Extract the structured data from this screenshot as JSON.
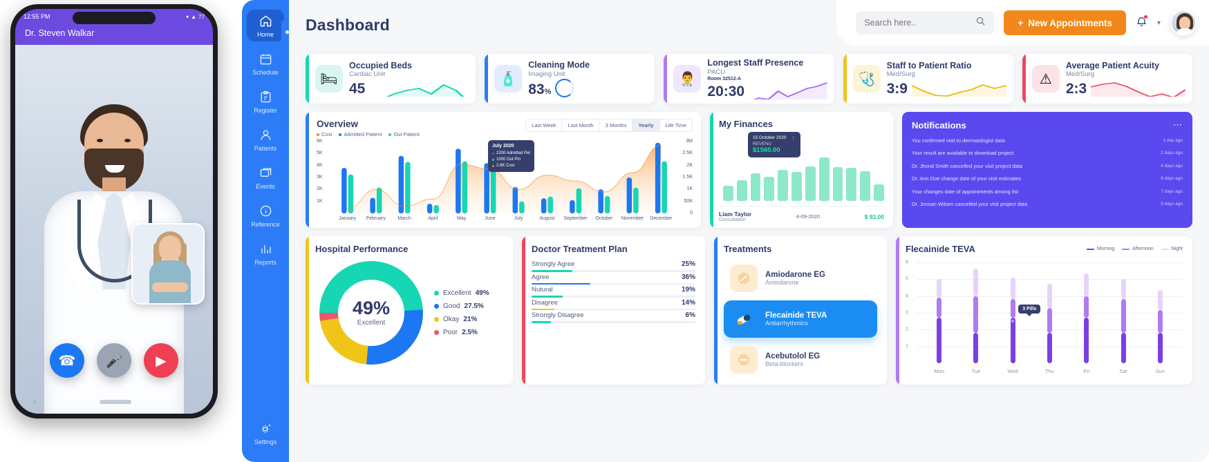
{
  "phone": {
    "status_time": "12:55 PM",
    "status_icons": "signal-wifi-battery",
    "battery": "77",
    "doctor_name": "Dr. Steven Walkar",
    "call_buttons": [
      {
        "name": "call-button",
        "glyph": "✆"
      },
      {
        "name": "mute-button",
        "glyph": "🎤"
      },
      {
        "name": "end-video-button",
        "glyph": "▶"
      }
    ],
    "back_glyph": "‹"
  },
  "sidebar": {
    "items": [
      {
        "label": "Home",
        "icon": "home-icon",
        "active": true
      },
      {
        "label": "Schedule",
        "icon": "calendar-icon",
        "active": false
      },
      {
        "label": "Register",
        "icon": "clipboard-edit-icon",
        "active": false
      },
      {
        "label": "Patients",
        "icon": "user-icon",
        "active": false
      },
      {
        "label": "Events",
        "icon": "layers-icon",
        "active": false
      },
      {
        "label": "Reference",
        "icon": "info-icon",
        "active": false
      },
      {
        "label": "Reports",
        "icon": "bar-chart-icon",
        "active": false
      }
    ],
    "bottom": {
      "label": "Settings",
      "icon": "gear-icon"
    }
  },
  "header": {
    "title": "Dashboard",
    "search_placeholder": "Search here..",
    "search_value": "",
    "search_icon": "search-icon",
    "new_appointments": "New Appointments",
    "plus": "+",
    "bell_icon": "bell-icon",
    "chevron": "▾",
    "accent_orange": "#f2881b"
  },
  "stats": [
    {
      "title": "Occupied Beds",
      "subtitle": "Cardiac Unit",
      "value": "45",
      "unit": "",
      "room": "",
      "bar_color": "#15d8b0",
      "icon_bg": "#d9f7f0",
      "icon": "patient-bed-icon",
      "glyph": "🛏",
      "spark_color": "#15d8b0",
      "spark_fill": "#d9f7f0",
      "spark": [
        46,
        30,
        22,
        17,
        14,
        22,
        9,
        17,
        34
      ],
      "mode": "spark"
    },
    {
      "title": "Cleaning Mode",
      "subtitle": "Imaging Unit",
      "value": "83",
      "unit": "%",
      "room": "",
      "bar_color": "#2b7cf6",
      "icon_bg": "#e3ecfd",
      "icon": "cleaning-supplies-icon",
      "glyph": "🧴",
      "spark_color": "#1b78f2",
      "spark_fill": "#e3ecfd",
      "spark": [],
      "mode": "ring",
      "ring_pct": "83"
    },
    {
      "title": "Longest Staff Presence",
      "subtitle": "PACU",
      "value": "20:30",
      "unit": "",
      "room": "Room 32512-A",
      "bar_color": "#b07bf0",
      "icon_bg": "#f0e6fd",
      "icon": "doctor-clock-icon",
      "glyph": "👨‍⚕",
      "spark_color": "#a765ef",
      "spark_fill": "#f0e6fd",
      "spark": [
        30,
        24,
        26,
        14,
        22,
        16,
        10,
        7,
        2
      ],
      "mode": "spark"
    },
    {
      "title": "Staff to Patient Ratio",
      "subtitle": "Med/Surg",
      "value": "3:9",
      "unit": "",
      "room": "",
      "bar_color": "#f0c419",
      "icon_bg": "#fdf4d6",
      "icon": "nurse-patient-icon",
      "glyph": "🩺",
      "spark_color": "#eab90f",
      "spark_fill": "#fdf4d6",
      "spark": [
        10,
        18,
        24,
        25,
        20,
        16,
        9,
        14,
        10
      ],
      "mode": "spark"
    },
    {
      "title": "Average Patient Acuity",
      "subtitle": "Med/Surg",
      "value": "2:3",
      "unit": "",
      "room": "",
      "bar_color": "#f0465e",
      "icon_bg": "#fde3e7",
      "icon": "warning-triangle-icon",
      "glyph": "⚠",
      "spark_color": "#f0556b",
      "spark_fill": "#fde3e7",
      "spark": [
        12,
        8,
        6,
        11,
        19,
        26,
        22,
        27,
        16
      ],
      "mode": "spark"
    }
  ],
  "overview": {
    "title": "Overview",
    "accent": "#2b7cf6",
    "legend": [
      {
        "label": "Cost",
        "color": "#f2881b"
      },
      {
        "label": "Admitted Patient",
        "color": "#1b78f2"
      },
      {
        "label": "Out Patient",
        "color": "#17d6b4"
      }
    ],
    "tabs": [
      {
        "label": "Last Week",
        "active": false
      },
      {
        "label": "Last Month",
        "active": false
      },
      {
        "label": "3 Months",
        "active": false
      },
      {
        "label": "Yearly",
        "active": true
      },
      {
        "label": "Life Time",
        "active": false
      }
    ],
    "tooltip": {
      "title": "July 2020",
      "rows": [
        {
          "label": "2200 Admitted Per",
          "color": "#1b78f2"
        },
        {
          "label": "1000 Out Pin",
          "color": "#17d6b4"
        },
        {
          "label": "2.8K Cost",
          "color": "#f2881b"
        }
      ]
    },
    "chart_data": {
      "type": "bar",
      "title": "Overview",
      "xlabel": "",
      "ylabel": "",
      "grid": false,
      "legend_position": "top-left",
      "categories": [
        "January",
        "February",
        "March",
        "April",
        "May",
        "June",
        "July",
        "August",
        "September",
        "October",
        "November",
        "December"
      ],
      "y_left_ticks": [
        "6K",
        "5K",
        "4K",
        "3K",
        "2K",
        "1K"
      ],
      "y_right_ticks": [
        "3M",
        "2.5K",
        "2K",
        "1.5K",
        "1K",
        "50K",
        "0"
      ],
      "ylim": [
        0,
        6000
      ],
      "series": [
        {
          "name": "Admitted Patient",
          "type": "bar",
          "color": "#1b78f2",
          "values": [
            3800,
            1300,
            4800,
            800,
            5400,
            4200,
            2200,
            1250,
            1100,
            2000,
            3000,
            5900
          ]
        },
        {
          "name": "Out Patient",
          "type": "bar",
          "color": "#17d6b4",
          "values": [
            3250,
            2150,
            4300,
            700,
            4350,
            3650,
            1000,
            1400,
            2100,
            1450,
            2150,
            4350
          ]
        },
        {
          "name": "Cost",
          "type": "area",
          "color": "#f2881b",
          "values": [
            400,
            2000,
            600,
            1200,
            4100,
            3700,
            2000,
            3200,
            2700,
            1800,
            3400,
            5700
          ]
        }
      ]
    }
  },
  "finances": {
    "title": "My Finances",
    "accent": "#15d8b0",
    "tooltip": {
      "date": "15 October 2020",
      "menu": "⋮",
      "label": "REVENU",
      "amount": "$1560.00"
    },
    "footer": {
      "name": "Liam Taylor",
      "sub": "Consultation",
      "date": "4-09-2020",
      "amount": "$ 92.00"
    },
    "chart_data": {
      "type": "bar",
      "title": "My Finances",
      "categories": [
        "1",
        "2",
        "3",
        "4",
        "5",
        "6",
        "7",
        "8",
        "9",
        "10",
        "11",
        "12"
      ],
      "values": [
        30,
        42,
        55,
        48,
        62,
        58,
        70,
        88,
        68,
        66,
        60,
        34
      ],
      "ylim": [
        0,
        100
      ],
      "color": "#8ee8cb"
    }
  },
  "notifications": {
    "title": "Notifications",
    "menu_icon": "more-horizontal-icon",
    "bg": "#5b49f0",
    "items": [
      {
        "text": "You confirmed visit to dermatologist data",
        "ago": "1 day ago"
      },
      {
        "text": "Your result are available to download project",
        "ago": "2 days ago"
      },
      {
        "text": "Dr. Jhond Smith cancelled your visit project data",
        "ago": "4 days ago"
      },
      {
        "text": "Dr. Ann Doe change date of your visit estimates",
        "ago": "6 days ago"
      },
      {
        "text": "Your changes date of appointments among list",
        "ago": "7 days ago"
      },
      {
        "text": "Dr. Jonsan Wilsen cancelled your visit project data",
        "ago": "9 days ago"
      }
    ]
  },
  "performance": {
    "title": "Hospital Performance",
    "accent": "#f0c419",
    "center_value": "49%",
    "center_label": "Excellent",
    "chart_data": {
      "type": "pie",
      "title": "Hospital Performance",
      "categories": [
        "Excellent",
        "Good",
        "Okay",
        "Poor"
      ],
      "values": [
        49,
        27.5,
        21,
        2.5
      ],
      "colors": [
        "#17d6b4",
        "#1b78f2",
        "#f0c419",
        "#f0556b"
      ],
      "legend_position": "right"
    },
    "legend": [
      {
        "label": "Excellent",
        "value": "49%",
        "color": "#17d6b4"
      },
      {
        "label": "Good",
        "value": "27.5%",
        "color": "#1b78f2"
      },
      {
        "label": "Okay",
        "value": "21%",
        "color": "#f0c419"
      },
      {
        "label": "Poor",
        "value": "2.5%",
        "color": "#f0556b"
      }
    ]
  },
  "treatment_plan": {
    "title": "Doctor Treatment Plan",
    "accent": "#f0465e",
    "chart_data": {
      "type": "bar",
      "title": "Doctor Treatment Plan",
      "categories": [
        "Strongly Agree",
        "Agree",
        "Nutural",
        "Disagree",
        "Strongly Disagree"
      ],
      "values": [
        25,
        36,
        19,
        14,
        6
      ],
      "ylim": [
        0,
        100
      ],
      "colors": [
        "#17d6b4",
        "#1b78f2",
        "#17d6b4",
        "#f0c419",
        "#17d6b4"
      ]
    },
    "rows": [
      {
        "label": "Strongly Agree",
        "value": "25%",
        "pct": 25,
        "color": "#17d6b4"
      },
      {
        "label": "Agree",
        "value": "36%",
        "pct": 36,
        "color": "#1b78f2"
      },
      {
        "label": "Nutural",
        "value": "19%",
        "pct": 19,
        "color": "#17d6b4"
      },
      {
        "label": "Disagree",
        "value": "14%",
        "pct": 14,
        "color": "#f0c419"
      },
      {
        "label": "Strongly Disagree",
        "value": "6%",
        "pct": 12,
        "color": "#17d6b4"
      }
    ]
  },
  "treatments": {
    "title": "Treatments",
    "accent": "#2b7cf6",
    "items": [
      {
        "name": "Amiodarone EG",
        "sub": "Amiodarone",
        "icon": "pill-round-icon",
        "glyph": "●",
        "selected": false
      },
      {
        "name": "Flecainide TEVA",
        "sub": "Antiarrhythmics",
        "icon": "capsule-icon",
        "glyph": "●",
        "selected": true
      },
      {
        "name": "Acebutolol EG",
        "sub": "Beta-blockers",
        "icon": "pill-oval-icon",
        "glyph": "▬",
        "selected": false
      }
    ]
  },
  "flecainide": {
    "title": "Flecainide TEVA",
    "accent": "#b07bf0",
    "legend": [
      {
        "label": "Morning",
        "color": "#7b3fe4"
      },
      {
        "label": "Afternoon",
        "color": "#b07bf0"
      },
      {
        "label": "Night",
        "color": "#e6d3fb"
      }
    ],
    "tooltip": "3 Pills",
    "chart_data": {
      "type": "bar",
      "title": "Flecainide TEVA",
      "stacked": true,
      "categories": [
        "Mon",
        "Tue",
        "Wed",
        "Thu",
        "Fri",
        "Sat",
        "Sun"
      ],
      "y_ticks": [
        1,
        2,
        3,
        4,
        5,
        6
      ],
      "ylim": [
        0,
        6
      ],
      "series": [
        {
          "name": "Morning",
          "color": "#7b3fe4",
          "values": [
            3,
            2,
            3,
            2,
            3,
            2,
            2
          ]
        },
        {
          "name": "Afternoon",
          "color": "#b07bf0",
          "values": [
            1.3,
            2.4,
            1.2,
            1.6,
            1.4,
            2.2,
            1.5
          ]
        },
        {
          "name": "Night",
          "color": "#e6d3fb",
          "values": [
            1.2,
            1.8,
            1.4,
            1.6,
            1.5,
            1.3,
            1.3
          ]
        }
      ]
    }
  }
}
